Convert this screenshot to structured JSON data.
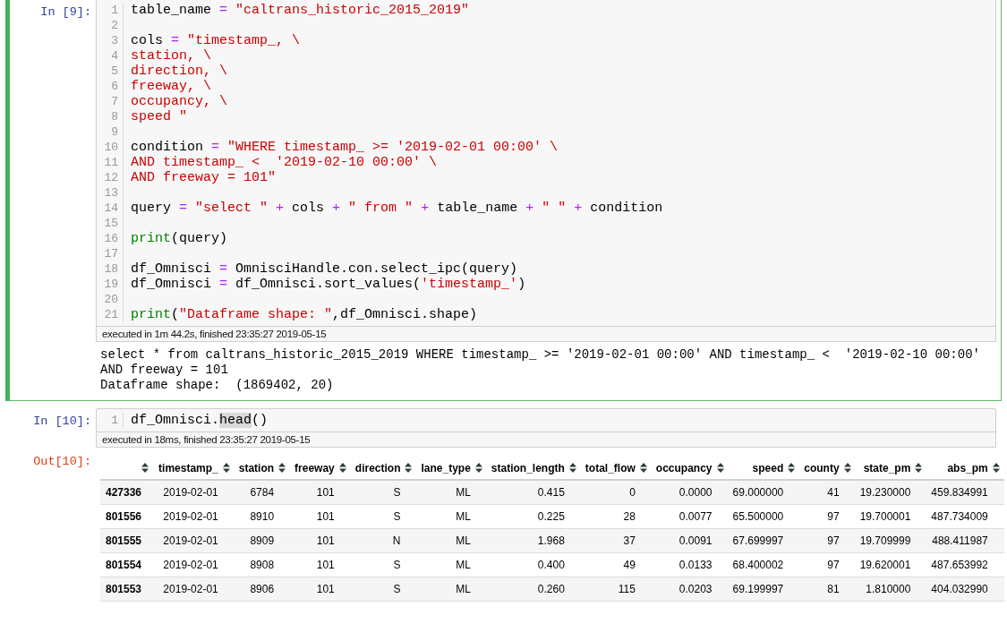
{
  "cells": [
    {
      "prompt": "In [9]:",
      "selected": true,
      "lines": [
        {
          "number": "1",
          "tokens": [
            {
              "kind": "name",
              "text": "table_name "
            },
            {
              "kind": "op",
              "text": "="
            },
            {
              "kind": "str",
              "text": " \"caltrans_historic_2015_2019\""
            }
          ]
        },
        {
          "number": "2"
        },
        {
          "number": "3",
          "tokens": [
            {
              "kind": "name",
              "text": "cols "
            },
            {
              "kind": "op",
              "text": "="
            },
            {
              "kind": "str",
              "text": " \"timestamp_, \\"
            }
          ]
        },
        {
          "number": "4",
          "tokens": [
            {
              "kind": "str",
              "text": "station, \\"
            }
          ]
        },
        {
          "number": "5",
          "tokens": [
            {
              "kind": "str",
              "text": "direction, \\"
            }
          ]
        },
        {
          "number": "6",
          "tokens": [
            {
              "kind": "str",
              "text": "freeway, \\"
            }
          ]
        },
        {
          "number": "7",
          "tokens": [
            {
              "kind": "str",
              "text": "occupancy, \\"
            }
          ]
        },
        {
          "number": "8",
          "tokens": [
            {
              "kind": "str",
              "text": "speed \""
            }
          ]
        },
        {
          "number": "9"
        },
        {
          "number": "10",
          "tokens": [
            {
              "kind": "name",
              "text": "condition "
            },
            {
              "kind": "op",
              "text": "="
            },
            {
              "kind": "str",
              "text": " \"WHERE timestamp_ >= '2019-02-01 00:00' \\"
            }
          ]
        },
        {
          "number": "11",
          "tokens": [
            {
              "kind": "str",
              "text": "AND timestamp_ <  '2019-02-10 00:00' \\"
            }
          ]
        },
        {
          "number": "12",
          "tokens": [
            {
              "kind": "str",
              "text": "AND freeway = 101\""
            }
          ]
        },
        {
          "number": "13"
        },
        {
          "number": "14",
          "tokens": [
            {
              "kind": "name",
              "text": "query "
            },
            {
              "kind": "op",
              "text": "="
            },
            {
              "kind": "str",
              "text": " \"select \" "
            },
            {
              "kind": "op",
              "text": "+"
            },
            {
              "kind": "name",
              "text": " cols "
            },
            {
              "kind": "op",
              "text": "+"
            },
            {
              "kind": "str",
              "text": " \" from \" "
            },
            {
              "kind": "op",
              "text": "+"
            },
            {
              "kind": "name",
              "text": " table_name "
            },
            {
              "kind": "op",
              "text": "+"
            },
            {
              "kind": "str",
              "text": " \" \" "
            },
            {
              "kind": "op",
              "text": "+"
            },
            {
              "kind": "name",
              "text": " condition"
            }
          ]
        },
        {
          "number": "15"
        },
        {
          "number": "16",
          "tokens": [
            {
              "kind": "builtin",
              "text": "print"
            },
            {
              "kind": "name",
              "text": "(query)"
            }
          ]
        },
        {
          "number": "17"
        },
        {
          "number": "18",
          "tokens": [
            {
              "kind": "name",
              "text": "df_Omnisci "
            },
            {
              "kind": "op",
              "text": "="
            },
            {
              "kind": "name",
              "text": " OmnisciHandle.con.select_ipc(query)"
            }
          ]
        },
        {
          "number": "19",
          "tokens": [
            {
              "kind": "name",
              "text": "df_Omnisci "
            },
            {
              "kind": "op",
              "text": "="
            },
            {
              "kind": "name",
              "text": " df_Omnisci.sort_values("
            },
            {
              "kind": "str",
              "text": "'timestamp_'"
            },
            {
              "kind": "name",
              "text": ")"
            }
          ]
        },
        {
          "number": "20"
        },
        {
          "number": "21",
          "tokens": [
            {
              "kind": "builtin",
              "text": "print"
            },
            {
              "kind": "name",
              "text": "("
            },
            {
              "kind": "str",
              "text": "\"Dataframe shape: \""
            },
            {
              "kind": "name",
              "text": ",df_Omnisci.shape)"
            }
          ]
        }
      ],
      "execution": "executed in 1m 44.2s, finished 23:35:27 2019-05-15",
      "stdout": [
        "select * from caltrans_historic_2015_2019 WHERE timestamp_ >= '2019-02-01 00:00' AND timestamp_ <  '2019-02-10 00:00'",
        "AND freeway = 101",
        "Dataframe shape:  (1869402, 20)"
      ]
    },
    {
      "prompt": "In [10]:",
      "selected": false,
      "lines": [
        {
          "number": "1",
          "tokens": [
            {
              "kind": "name",
              "text": "df_Omnisci."
            },
            {
              "kind": "match",
              "text": "head"
            },
            {
              "kind": "name",
              "text": "()"
            }
          ]
        }
      ],
      "execution": "executed in 18ms, finished 23:35:27 2019-05-15",
      "out_prompt": "Out[10]:",
      "table": {
        "columns": [
          "timestamp_",
          "station",
          "freeway",
          "direction",
          "lane_type",
          "station_length",
          "total_flow",
          "occupancy",
          "speed",
          "county",
          "state_pm",
          "abs_pm"
        ],
        "rows": [
          {
            "index": "427336",
            "cells": [
              "2019-02-01",
              "6784",
              "101",
              "S",
              "ML",
              "0.415",
              "0",
              "0.0000",
              "69.000000",
              "41",
              "19.230000",
              "459.834991"
            ]
          },
          {
            "index": "801556",
            "cells": [
              "2019-02-01",
              "8910",
              "101",
              "S",
              "ML",
              "0.225",
              "28",
              "0.0077",
              "65.500000",
              "97",
              "19.700001",
              "487.734009"
            ]
          },
          {
            "index": "801555",
            "cells": [
              "2019-02-01",
              "8909",
              "101",
              "N",
              "ML",
              "1.968",
              "37",
              "0.0091",
              "67.699997",
              "97",
              "19.709999",
              "488.411987"
            ]
          },
          {
            "index": "801554",
            "cells": [
              "2019-02-01",
              "8908",
              "101",
              "S",
              "ML",
              "0.400",
              "49",
              "0.0133",
              "68.400002",
              "97",
              "19.620001",
              "487.653992"
            ]
          },
          {
            "index": "801553",
            "cells": [
              "2019-02-01",
              "8906",
              "101",
              "S",
              "ML",
              "0.260",
              "115",
              "0.0203",
              "69.199997",
              "81",
              "1.810000",
              "404.032990"
            ]
          }
        ]
      }
    }
  ]
}
